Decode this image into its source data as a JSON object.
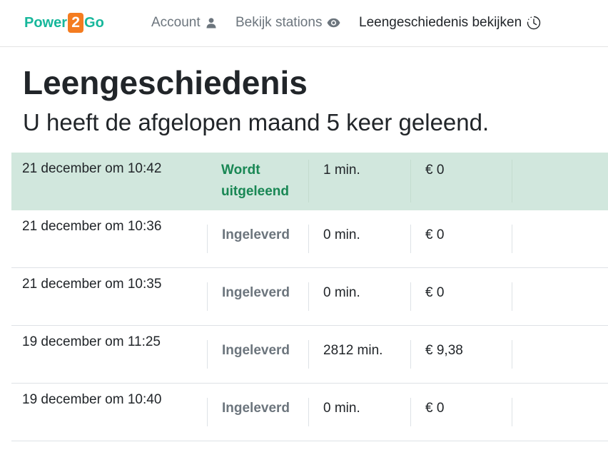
{
  "brand": {
    "part1": "Power",
    "part2": "2",
    "part3": "Go",
    "accent": "#17b79b",
    "accent2": "#f47c20"
  },
  "nav": {
    "account": {
      "label": "Account",
      "icon": "person-icon"
    },
    "stations": {
      "label": "Bekijk stations",
      "icon": "eye-icon"
    },
    "history": {
      "label": "Leengeschiedenis bekijken",
      "icon": "clock-icon"
    }
  },
  "page": {
    "title": "Leengeschiedenis",
    "subtitle": "U heeft de afgelopen maand 5 keer geleend."
  },
  "rentals": [
    {
      "date": "21 december om 10:42",
      "status_line1": "Wordt",
      "status_line2": "uitgeleend",
      "duration": "1 min.",
      "cost": "€ 0",
      "current": true
    },
    {
      "date": "21 december om 10:36",
      "status_line1": "Ingeleverd",
      "status_line2": "",
      "duration": "0 min.",
      "cost": "€ 0",
      "current": false
    },
    {
      "date": "21 december om 10:35",
      "status_line1": "Ingeleverd",
      "status_line2": "",
      "duration": "0 min.",
      "cost": "€ 0",
      "current": false
    },
    {
      "date": "19 december om 11:25",
      "status_line1": "Ingeleverd",
      "status_line2": "",
      "duration": "2812 min.",
      "cost": "€ 9,38",
      "current": false
    },
    {
      "date": "19 december om 10:40",
      "status_line1": "Ingeleverd",
      "status_line2": "",
      "duration": "0 min.",
      "cost": "€ 0",
      "current": false
    }
  ]
}
